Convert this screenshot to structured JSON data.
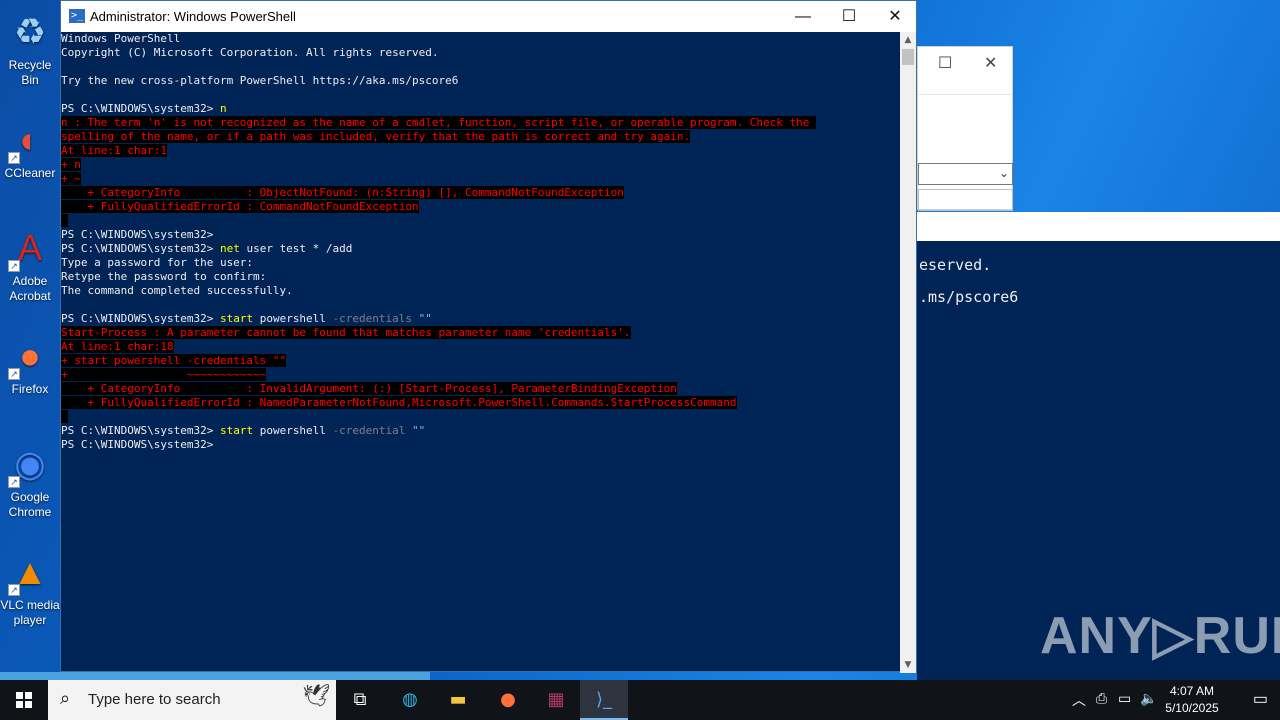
{
  "desktop": {
    "icons": [
      {
        "label": "Recycle Bin",
        "glyph": "♻",
        "color": "#9bd0f5"
      },
      {
        "label": "CCleaner",
        "glyph": "◐",
        "color": "#e84c3d"
      },
      {
        "label": "Adobe Acrobat",
        "glyph": "A",
        "color": "#d7261e"
      },
      {
        "label": "Firefox",
        "glyph": "●",
        "color": "#ff7139"
      },
      {
        "label": "Google Chrome",
        "glyph": "◉",
        "color": "#4285f4"
      },
      {
        "label": "VLC media player",
        "glyph": "▲",
        "color": "#f08a00"
      }
    ]
  },
  "background_console": {
    "line1": "eserved.",
    "line2": ".ms/pscore6"
  },
  "watermark": "ANY▷RUN",
  "powershell": {
    "title": "Administrator: Windows PowerShell",
    "lines": [
      {
        "parts": [
          {
            "t": "Windows PowerShell",
            "c": "txt"
          }
        ]
      },
      {
        "parts": [
          {
            "t": "Copyright (C) Microsoft Corporation. All rights reserved.",
            "c": "txt"
          }
        ]
      },
      {
        "parts": [
          {
            "t": "",
            "c": "txt"
          }
        ]
      },
      {
        "parts": [
          {
            "t": "Try the new cross-platform PowerShell https://aka.ms/pscore6",
            "c": "txt"
          }
        ]
      },
      {
        "parts": [
          {
            "t": "",
            "c": "txt"
          }
        ]
      },
      {
        "parts": [
          {
            "t": "PS C:\\WINDOWS\\system32> ",
            "c": "txt"
          },
          {
            "t": "n",
            "c": "cmd"
          }
        ]
      },
      {
        "parts": [
          {
            "t": "n : The term 'n' is not recognized as the name of a cmdlet, function, script file, or operable program. Check the ",
            "c": "err"
          }
        ]
      },
      {
        "parts": [
          {
            "t": "spelling of the name, or if a path was included, verify that the path is correct and try again.",
            "c": "err"
          }
        ]
      },
      {
        "parts": [
          {
            "t": "At line:1 char:1",
            "c": "err"
          }
        ]
      },
      {
        "parts": [
          {
            "t": "+ n",
            "c": "err"
          }
        ]
      },
      {
        "parts": [
          {
            "t": "+ ~",
            "c": "err"
          }
        ]
      },
      {
        "parts": [
          {
            "t": "    + CategoryInfo          : ObjectNotFound: (n:String) [], CommandNotFoundException",
            "c": "err"
          }
        ]
      },
      {
        "parts": [
          {
            "t": "    + FullyQualifiedErrorId : CommandNotFoundException",
            "c": "err"
          }
        ]
      },
      {
        "parts": [
          {
            "t": " ",
            "c": "blk"
          }
        ]
      },
      {
        "parts": [
          {
            "t": "PS C:\\WINDOWS\\system32>",
            "c": "txt"
          }
        ]
      },
      {
        "parts": [
          {
            "t": "PS C:\\WINDOWS\\system32> ",
            "c": "txt"
          },
          {
            "t": "net",
            "c": "cmd"
          },
          {
            "t": " user test * /add",
            "c": "txt"
          }
        ]
      },
      {
        "parts": [
          {
            "t": "Type a password for the user:",
            "c": "txt"
          }
        ]
      },
      {
        "parts": [
          {
            "t": "Retype the password to confirm:",
            "c": "txt"
          }
        ]
      },
      {
        "parts": [
          {
            "t": "The command completed successfully.",
            "c": "txt"
          }
        ]
      },
      {
        "parts": [
          {
            "t": "",
            "c": "txt"
          }
        ]
      },
      {
        "parts": [
          {
            "t": "PS C:\\WINDOWS\\system32> ",
            "c": "txt"
          },
          {
            "t": "start",
            "c": "cmd"
          },
          {
            "t": " powershell ",
            "c": "txt"
          },
          {
            "t": "-credentials",
            "c": "arg"
          },
          {
            "t": " \"\"",
            "c": "str"
          }
        ]
      },
      {
        "parts": [
          {
            "t": "Start-Process : A parameter cannot be found that matches parameter name 'credentials'.",
            "c": "err"
          }
        ]
      },
      {
        "parts": [
          {
            "t": "At line:1 char:18",
            "c": "err"
          }
        ]
      },
      {
        "parts": [
          {
            "t": "+ start powershell -credentials \"\"",
            "c": "err"
          }
        ]
      },
      {
        "parts": [
          {
            "t": "+                  ~~~~~~~~~~~~",
            "c": "err"
          }
        ]
      },
      {
        "parts": [
          {
            "t": "    + CategoryInfo          : InvalidArgument: (:) [Start-Process], ParameterBindingException",
            "c": "err"
          }
        ]
      },
      {
        "parts": [
          {
            "t": "    + FullyQualifiedErrorId : NamedParameterNotFound,Microsoft.PowerShell.Commands.StartProcessCommand",
            "c": "err"
          }
        ]
      },
      {
        "parts": [
          {
            "t": " ",
            "c": "blk"
          }
        ]
      },
      {
        "parts": [
          {
            "t": "PS C:\\WINDOWS\\system32> ",
            "c": "txt"
          },
          {
            "t": "start",
            "c": "cmd"
          },
          {
            "t": " powershell ",
            "c": "txt"
          },
          {
            "t": "-credential",
            "c": "arg"
          },
          {
            "t": " \"\"",
            "c": "str"
          }
        ]
      },
      {
        "parts": [
          {
            "t": "PS C:\\WINDOWS\\system32>",
            "c": "txt"
          }
        ]
      }
    ]
  },
  "taskbar": {
    "search_placeholder": "Type here to search",
    "apps": [
      {
        "name": "task-view",
        "glyph": "⧉",
        "color": "#ffffff"
      },
      {
        "name": "edge",
        "glyph": "◍",
        "color": "#2fb5e0"
      },
      {
        "name": "file-explorer",
        "glyph": "▬",
        "color": "#f5c542"
      },
      {
        "name": "firefox",
        "glyph": "●",
        "color": "#ff7139"
      },
      {
        "name": "winrar",
        "glyph": "▦",
        "color": "#b03a6a"
      },
      {
        "name": "powershell",
        "glyph": "⟩_",
        "color": "#5ea0ef"
      }
    ],
    "time": "4:07 AM",
    "date": "5/10/2025"
  }
}
